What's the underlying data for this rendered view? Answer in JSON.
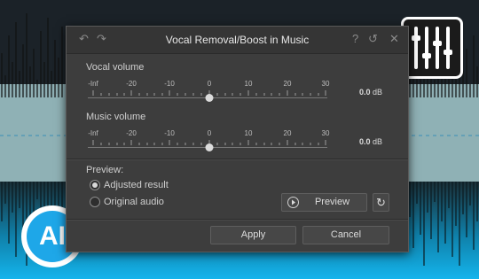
{
  "dialog": {
    "title": "Vocal Removal/Boost in Music",
    "help_icon": "?",
    "back_icon": "undo-arrow-icon",
    "forward_icon": "redo-arrow-icon",
    "close_icon": "close-icon"
  },
  "vocal": {
    "label": "Vocal volume",
    "ticks": [
      "-Inf",
      "-20",
      "-10",
      "0",
      "10",
      "20",
      "30"
    ],
    "value": "0.0",
    "unit": "dB"
  },
  "music": {
    "label": "Music volume",
    "ticks": [
      "-Inf",
      "-20",
      "-10",
      "0",
      "10",
      "20",
      "30"
    ],
    "value": "0.0",
    "unit": "dB"
  },
  "preview": {
    "heading": "Preview:",
    "option_adjusted": "Adjusted result",
    "option_original": "Original audio",
    "selected": "Adjusted result",
    "preview_button": "Preview"
  },
  "footer": {
    "apply": "Apply",
    "cancel": "Cancel"
  },
  "badge": {
    "text": "AI"
  },
  "colors": {
    "accent_blue": "#1ea7e8",
    "waveform_fill": "#9cc0c4"
  }
}
